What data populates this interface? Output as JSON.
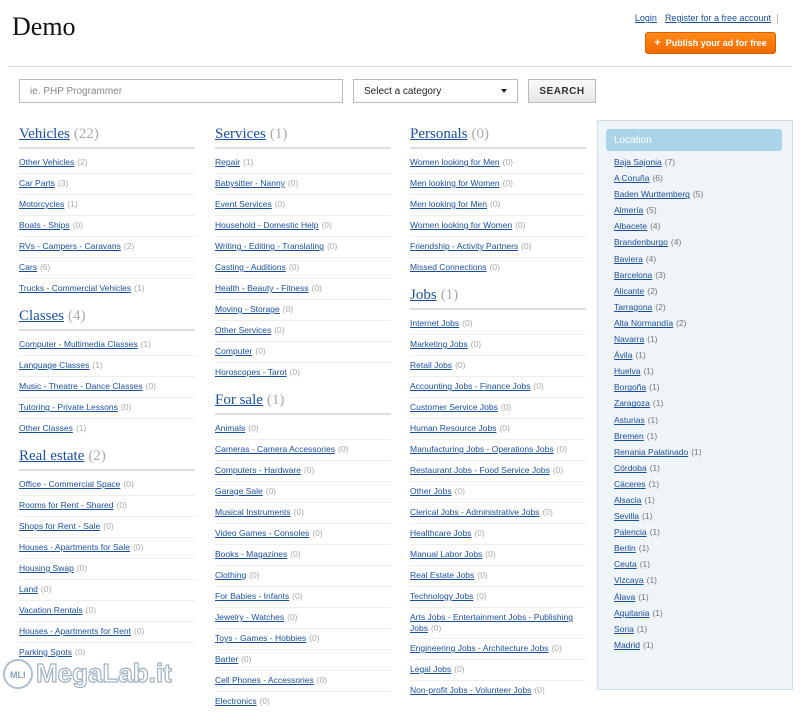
{
  "header": {
    "logo": "Demo",
    "login_label": "Login",
    "register_label": "Register for a free account",
    "publish_label": "Publish your ad for free"
  },
  "search": {
    "placeholder": "ie. PHP Programmer",
    "category_selected": "Select a category",
    "button_label": "SEARCH"
  },
  "columns": [
    [
      {
        "title": "Vehicles",
        "count": "(22)",
        "items": [
          {
            "label": "Other Vehicles",
            "count": "(2)"
          },
          {
            "label": "Car Parts",
            "count": "(3)"
          },
          {
            "label": "Motorcycles",
            "count": "(1)"
          },
          {
            "label": "Boats - Ships",
            "count": "(0)"
          },
          {
            "label": "RVs - Campers - Caravans",
            "count": "(2)"
          },
          {
            "label": "Cars",
            "count": "(6)"
          },
          {
            "label": "Trucks - Commercial Vehicles",
            "count": "(1)"
          }
        ]
      },
      {
        "title": "Classes",
        "count": "(4)",
        "items": [
          {
            "label": "Computer - Multimedia Classes",
            "count": "(1)"
          },
          {
            "label": "Language Classes",
            "count": "(1)"
          },
          {
            "label": "Music - Theatre - Dance Classes",
            "count": "(0)"
          },
          {
            "label": "Tutoring - Private Lessons",
            "count": "(0)"
          },
          {
            "label": "Other Classes",
            "count": "(1)"
          }
        ]
      },
      {
        "title": "Real estate",
        "count": "(2)",
        "items": [
          {
            "label": "Office - Commercial Space",
            "count": "(0)"
          },
          {
            "label": "Rooms for Rent - Shared",
            "count": "(0)"
          },
          {
            "label": "Shops for Rent - Sale",
            "count": "(0)"
          },
          {
            "label": "Houses - Apartments for Sale",
            "count": "(0)"
          },
          {
            "label": "Housing Swap",
            "count": "(0)"
          },
          {
            "label": "Land",
            "count": "(0)"
          },
          {
            "label": "Vacation Rentals",
            "count": "(0)"
          },
          {
            "label": "Houses - Apartments for Rent",
            "count": "(0)"
          },
          {
            "label": "Parking Spots",
            "count": "(0)"
          }
        ]
      }
    ],
    [
      {
        "title": "Services",
        "count": "(1)",
        "items": [
          {
            "label": "Repair",
            "count": "(1)"
          },
          {
            "label": "Babysitter - Nanny",
            "count": "(0)"
          },
          {
            "label": "Event Services",
            "count": "(0)"
          },
          {
            "label": "Household - Domestic Help",
            "count": "(0)"
          },
          {
            "label": "Writing - Editing - Translating",
            "count": "(0)"
          },
          {
            "label": "Casting - Auditions",
            "count": "(0)"
          },
          {
            "label": "Health - Beauty - Fitness",
            "count": "(0)"
          },
          {
            "label": "Moving - Storage",
            "count": "(0)"
          },
          {
            "label": "Other Services",
            "count": "(0)"
          },
          {
            "label": "Computer",
            "count": "(0)"
          },
          {
            "label": "Horoscopes - Tarot",
            "count": "(0)"
          }
        ]
      },
      {
        "title": "For sale",
        "count": "(1)",
        "items": [
          {
            "label": "Animals",
            "count": "(0)"
          },
          {
            "label": "Cameras - Camera Accessories",
            "count": "(0)"
          },
          {
            "label": "Computers - Hardware",
            "count": "(0)"
          },
          {
            "label": "Garage Sale",
            "count": "(0)"
          },
          {
            "label": "Musical Instruments",
            "count": "(0)"
          },
          {
            "label": "Video Games - Consoles",
            "count": "(0)"
          },
          {
            "label": "Books - Magazines",
            "count": "(0)"
          },
          {
            "label": "Clothing",
            "count": "(0)"
          },
          {
            "label": "For Babies - Infants",
            "count": "(0)"
          },
          {
            "label": "Jewelry - Watches",
            "count": "(0)"
          },
          {
            "label": "Toys - Games - Hobbies",
            "count": "(0)"
          },
          {
            "label": "Barter",
            "count": "(0)"
          },
          {
            "label": "Cell Phones - Accessories",
            "count": "(0)"
          },
          {
            "label": "Electronics",
            "count": "(0)"
          }
        ]
      }
    ],
    [
      {
        "title": "Personals",
        "count": "(0)",
        "items": [
          {
            "label": "Women looking for Men",
            "count": "(0)"
          },
          {
            "label": "Men looking for Women",
            "count": "(0)"
          },
          {
            "label": "Men looking for Men",
            "count": "(0)"
          },
          {
            "label": "Women looking for Women",
            "count": "(0)"
          },
          {
            "label": "Friendship - Activity Partners",
            "count": "(0)"
          },
          {
            "label": "Missed Connections",
            "count": "(0)"
          }
        ]
      },
      {
        "title": "Jobs",
        "count": "(1)",
        "items": [
          {
            "label": "Internet Jobs",
            "count": "(0)"
          },
          {
            "label": "Marketing Jobs",
            "count": "(0)"
          },
          {
            "label": "Retail Jobs",
            "count": "(0)"
          },
          {
            "label": "Accounting Jobs - Finance Jobs",
            "count": "(0)"
          },
          {
            "label": "Customer Service Jobs",
            "count": "(0)"
          },
          {
            "label": "Human Resource Jobs",
            "count": "(0)"
          },
          {
            "label": "Manufacturing Jobs - Operations Jobs",
            "count": "(0)"
          },
          {
            "label": "Restaurant Jobs - Food Service Jobs",
            "count": "(0)"
          },
          {
            "label": "Other Jobs",
            "count": "(0)"
          },
          {
            "label": "Clerical Jobs - Administrative Jobs",
            "count": "(0)"
          },
          {
            "label": "Healthcare Jobs",
            "count": "(0)"
          },
          {
            "label": "Manual Labor Jobs",
            "count": "(0)"
          },
          {
            "label": "Real Estate Jobs",
            "count": "(0)"
          },
          {
            "label": "Technology Jobs",
            "count": "(0)"
          },
          {
            "label": "Arts Jobs - Entertainment Jobs - Publishing Jobs",
            "count": "(0)"
          },
          {
            "label": "Engineering Jobs - Architecture Jobs",
            "count": "(0)"
          },
          {
            "label": "Legal Jobs",
            "count": "(0)"
          },
          {
            "label": "Non-profit Jobs - Volunteer Jobs",
            "count": "(0)"
          }
        ]
      }
    ]
  ],
  "location": {
    "title": "Location",
    "items": [
      {
        "label": "Baja Sajonia",
        "count": "(7)"
      },
      {
        "label": "A Coruña",
        "count": "(6)"
      },
      {
        "label": "Baden Wurttemberg",
        "count": "(5)"
      },
      {
        "label": "Almería",
        "count": "(5)"
      },
      {
        "label": "Albacete",
        "count": "(4)"
      },
      {
        "label": "Brandenburgo",
        "count": "(4)"
      },
      {
        "label": "Baviera",
        "count": "(4)"
      },
      {
        "label": "Barcelona",
        "count": "(3)"
      },
      {
        "label": "Alicante",
        "count": "(2)"
      },
      {
        "label": "Tarragona",
        "count": "(2)"
      },
      {
        "label": "Alta Normandía",
        "count": "(2)"
      },
      {
        "label": "Navarra",
        "count": "(1)"
      },
      {
        "label": "Ávila",
        "count": "(1)"
      },
      {
        "label": "Huelva",
        "count": "(1)"
      },
      {
        "label": "Borgoña",
        "count": "(1)"
      },
      {
        "label": "Zaragoza",
        "count": "(1)"
      },
      {
        "label": "Asturias",
        "count": "(1)"
      },
      {
        "label": "Bremen",
        "count": "(1)"
      },
      {
        "label": "Renania Palatinado",
        "count": "(1)"
      },
      {
        "label": "Córdoba",
        "count": "(1)"
      },
      {
        "label": "Cáceres",
        "count": "(1)"
      },
      {
        "label": "Alsacia",
        "count": "(1)"
      },
      {
        "label": "Sevilla",
        "count": "(1)"
      },
      {
        "label": "Palencia",
        "count": "(1)"
      },
      {
        "label": "Berlin",
        "count": "(1)"
      },
      {
        "label": "Ceuta",
        "count": "(1)"
      },
      {
        "label": "Vizcaya",
        "count": "(1)"
      },
      {
        "label": "Álava",
        "count": "(1)"
      },
      {
        "label": "Aquitania",
        "count": "(1)"
      },
      {
        "label": "Soria",
        "count": "(1)"
      },
      {
        "label": "Madrid",
        "count": "(1)"
      }
    ]
  },
  "watermark": {
    "text": "MegaLab.it"
  },
  "colors": {
    "link": "#1a4f9c",
    "accent": "#f06a00",
    "location_header": "#a9d4ea"
  }
}
